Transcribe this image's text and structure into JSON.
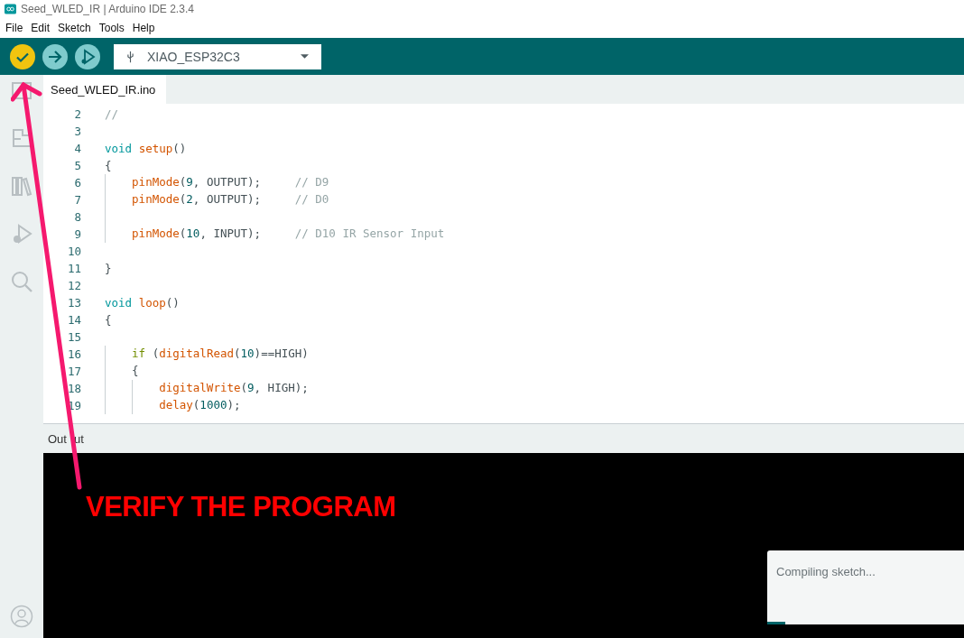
{
  "window": {
    "title": "Seed_WLED_IR | Arduino IDE 2.3.4"
  },
  "menu": [
    "File",
    "Edit",
    "Sketch",
    "Tools",
    "Help"
  ],
  "toolbar": {
    "buttons": [
      {
        "kind": "verify",
        "selected": true
      },
      {
        "kind": "upload",
        "selected": false
      },
      {
        "kind": "debug",
        "selected": false
      }
    ],
    "board": "XIAO_ESP32C3"
  },
  "tabs": [
    {
      "label": "Seed_WLED_IR.ino",
      "selected": true
    }
  ],
  "sidebar": {
    "items": [
      {
        "kind": "sketchbook"
      },
      {
        "kind": "boards"
      },
      {
        "kind": "library"
      },
      {
        "kind": "debug"
      },
      {
        "kind": "search"
      }
    ],
    "bottom": {
      "kind": "account"
    }
  },
  "editor": {
    "lines": [
      {
        "number": "2",
        "tokens": [
          {
            "text": "//",
            "kind": "comment"
          }
        ]
      },
      {
        "number": "3"
      },
      {
        "number": "4",
        "tokens": [
          {
            "text": "void",
            "kind": "type"
          },
          {
            "text": " setup",
            "kind": "function"
          },
          {
            "text": "()",
            "kind": "plain"
          }
        ]
      },
      {
        "number": "5",
        "tokens": [
          {
            "text": "{",
            "kind": "plain"
          }
        ]
      },
      {
        "number": "6",
        "tokens": [
          {
            "text": "    pinMode",
            "kind": "function"
          },
          {
            "text": "(",
            "kind": "plain"
          },
          {
            "text": "9",
            "kind": "number"
          },
          {
            "text": ", OUTPUT);     ",
            "kind": "plain"
          },
          {
            "text": "// D9",
            "kind": "comment"
          }
        ]
      },
      {
        "number": "7",
        "tokens": [
          {
            "text": "    pinMode",
            "kind": "function"
          },
          {
            "text": "(",
            "kind": "plain"
          },
          {
            "text": "2",
            "kind": "number"
          },
          {
            "text": ", OUTPUT);     ",
            "kind": "plain"
          },
          {
            "text": "// D0",
            "kind": "comment"
          }
        ]
      },
      {
        "number": "8"
      },
      {
        "number": "9",
        "tokens": [
          {
            "text": "    pinMode",
            "kind": "function"
          },
          {
            "text": "(",
            "kind": "plain"
          },
          {
            "text": "10",
            "kind": "number"
          },
          {
            "text": ", INPUT);     ",
            "kind": "plain"
          },
          {
            "text": "// D10 IR Sensor Input",
            "kind": "comment"
          }
        ]
      },
      {
        "number": "10"
      },
      {
        "number": "11",
        "tokens": [
          {
            "text": "}",
            "kind": "plain"
          }
        ]
      },
      {
        "number": "12"
      },
      {
        "number": "13",
        "tokens": [
          {
            "text": "void",
            "kind": "type"
          },
          {
            "text": " loop",
            "kind": "function"
          },
          {
            "text": "()",
            "kind": "plain"
          }
        ]
      },
      {
        "number": "14",
        "tokens": [
          {
            "text": "{",
            "kind": "plain"
          }
        ]
      },
      {
        "number": "15"
      },
      {
        "number": "16",
        "tokens": [
          {
            "text": "    if",
            "kind": "keyword"
          },
          {
            "text": " (",
            "kind": "plain"
          },
          {
            "text": "digitalRead",
            "kind": "function"
          },
          {
            "text": "(",
            "kind": "plain"
          },
          {
            "text": "10",
            "kind": "number"
          },
          {
            "text": ")==HIGH)",
            "kind": "plain"
          }
        ]
      },
      {
        "number": "17",
        "tokens": [
          {
            "text": "    {",
            "kind": "plain"
          }
        ]
      },
      {
        "number": "18",
        "tokens": [
          {
            "text": "        digitalWrite",
            "kind": "function"
          },
          {
            "text": "(",
            "kind": "plain"
          },
          {
            "text": "9",
            "kind": "number"
          },
          {
            "text": ", HIGH);",
            "kind": "plain"
          }
        ]
      },
      {
        "number": "19",
        "tokens": [
          {
            "text": "        delay",
            "kind": "function"
          },
          {
            "text": "(",
            "kind": "plain"
          },
          {
            "text": "1000",
            "kind": "number"
          },
          {
            "text": ");",
            "kind": "plain"
          }
        ]
      }
    ]
  },
  "output": {
    "title": [
      "Out",
      "ut"
    ]
  },
  "notification": {
    "message": "Compiling sketch...",
    "level": 0.09
  },
  "annotation": {
    "text": "VERIFY THE PROGRAM"
  }
}
